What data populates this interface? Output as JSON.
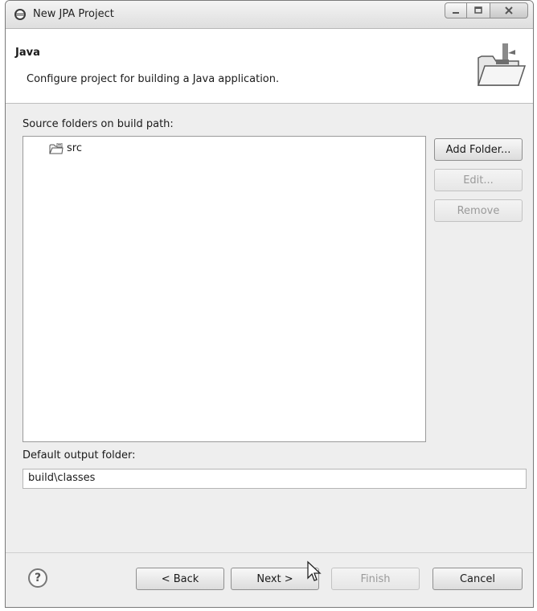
{
  "window": {
    "title": "New JPA Project"
  },
  "banner": {
    "title": "Java",
    "description": "Configure project for building a Java application.",
    "icon": "new-project-folder-icon"
  },
  "source_folders": {
    "label": "Source folders on build path:",
    "items": [
      {
        "label": "src",
        "icon": "source-folder-icon"
      }
    ]
  },
  "side_buttons": {
    "add_folder": "Add Folder...",
    "edit": "Edit...",
    "remove": "Remove"
  },
  "output": {
    "label": "Default output folder:",
    "value": "build\\classes"
  },
  "footer": {
    "back": "< Back",
    "next": "Next >",
    "finish": "Finish",
    "cancel": "Cancel",
    "help_icon": "help-icon"
  }
}
